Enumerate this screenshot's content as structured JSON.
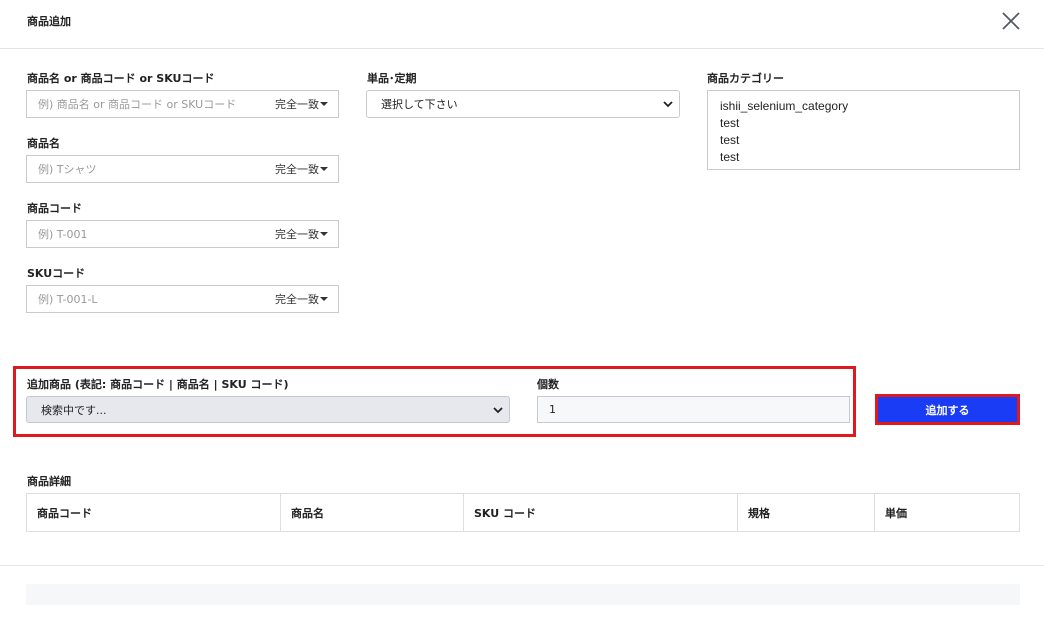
{
  "modal": {
    "title": "商品追加"
  },
  "filters": {
    "product_or_code": {
      "label": "商品名 or 商品コード or SKUコード",
      "placeholder": "例) 商品名 or 商品コード or SKUコード",
      "match": "完全一致"
    },
    "product_name": {
      "label": "商品名",
      "placeholder": "例) Tシャツ",
      "match": "完全一致"
    },
    "product_code": {
      "label": "商品コード",
      "placeholder": "例) T-001",
      "match": "完全一致"
    },
    "sku_code": {
      "label": "SKUコード",
      "placeholder": "例) T-001-L",
      "match": "完全一致"
    },
    "purchase_type": {
      "label": "単品･定期",
      "selected": "選択して下さい"
    },
    "category": {
      "label": "商品カテゴリー",
      "options": [
        "ishii_selenium_category",
        "test",
        "test",
        "test"
      ]
    }
  },
  "add_product": {
    "label": "追加商品 (表記: 商品コード | 商品名 | SKU コード)",
    "selected": "検索中です...",
    "quantity_label": "個数",
    "quantity_value": "1",
    "button_label": "追加する"
  },
  "details": {
    "label": "商品詳細",
    "columns": [
      "商品コード",
      "商品名",
      "SKU コード",
      "規格",
      "単価"
    ]
  },
  "colors": {
    "accent": "#1a3cf5",
    "highlight": "#e0191e"
  }
}
